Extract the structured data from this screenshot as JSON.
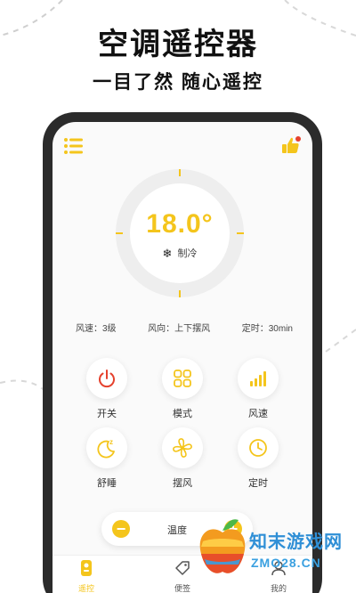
{
  "promo": {
    "headline": "空调遥控器",
    "subline": "一目了然  随心遥控"
  },
  "top_bar": {
    "menu_icon": "menu-icon",
    "rate_icon": "thumbs-up-icon"
  },
  "dial": {
    "temperature": "18.0°",
    "mode_icon": "snowflake-icon",
    "mode_label": "制冷"
  },
  "status": {
    "wind_speed": "风速：3级",
    "wind_direction": "风向：上下摆风",
    "timer": "定时：30min"
  },
  "controls": [
    {
      "label": "开关",
      "icon": "power-icon"
    },
    {
      "label": "模式",
      "icon": "grid-icon"
    },
    {
      "label": "风速",
      "icon": "signal-bars-icon"
    },
    {
      "label": "舒睡",
      "icon": "moon-sleep-icon"
    },
    {
      "label": "摆风",
      "icon": "fan-icon"
    },
    {
      "label": "定时",
      "icon": "clock-icon"
    }
  ],
  "temp_control": {
    "label": "温度",
    "minus": "−",
    "plus": "+"
  },
  "tabs": [
    {
      "label": "遥控",
      "icon": "remote-icon",
      "active": true
    },
    {
      "label": "便签",
      "icon": "tag-icon",
      "active": false
    },
    {
      "label": "我的",
      "icon": "user-icon",
      "active": false
    }
  ],
  "watermark": {
    "line1": "知末游戏网",
    "line2": "ZMO28.CN"
  },
  "colors": {
    "accent": "#f4c51c",
    "phone_frame": "#2b2b2b",
    "watermark_blue": "#2f8fd6"
  }
}
